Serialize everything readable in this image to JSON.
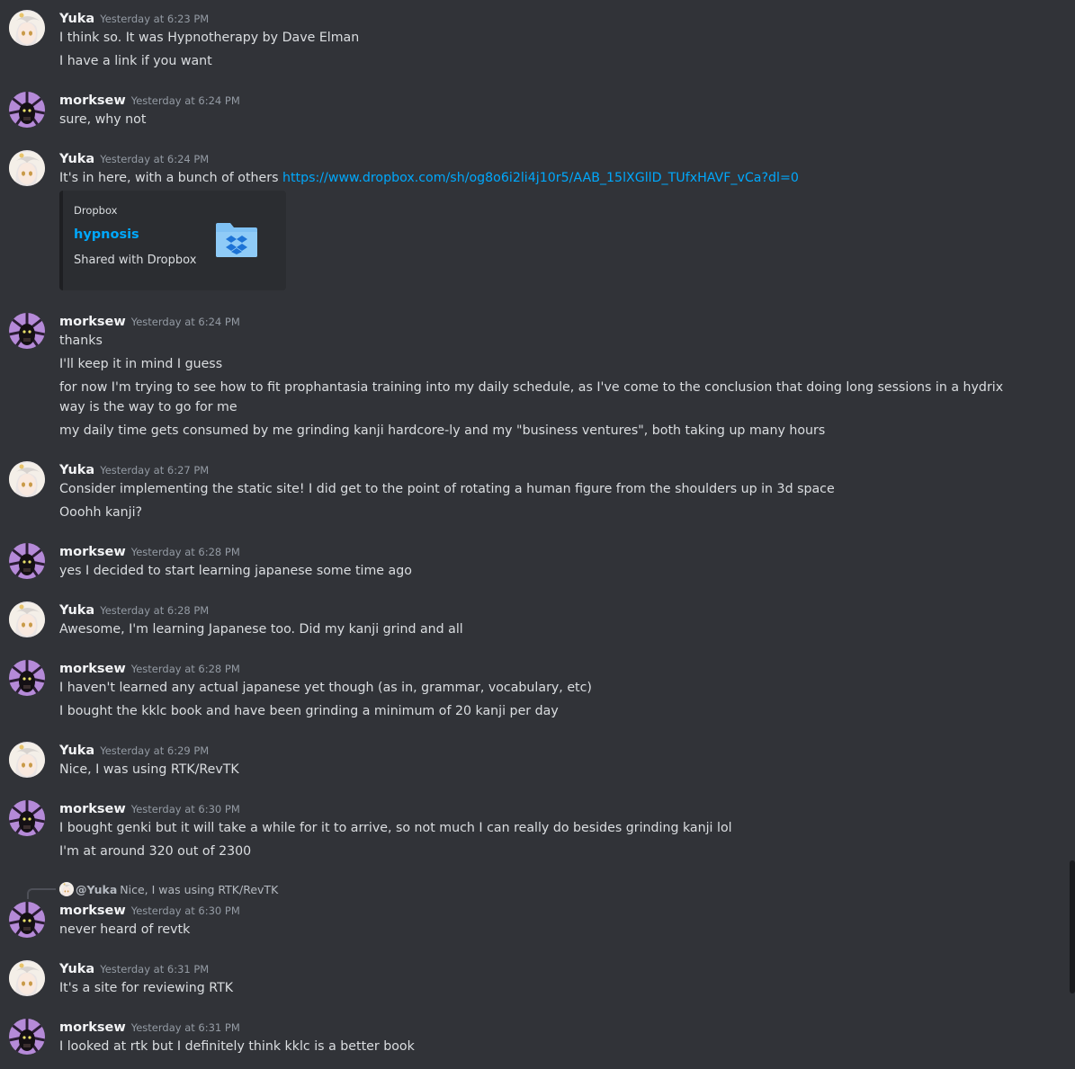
{
  "messages": [
    {
      "author": "Yuka",
      "avatar": "yuka",
      "time": "Yesterday at 6:23 PM",
      "lines": [
        "I think so. It was Hypnotherapy by Dave Elman",
        "I have a link if you want"
      ]
    },
    {
      "author": "morksew",
      "avatar": "morksew",
      "time": "Yesterday at 6:24 PM",
      "lines": [
        "sure, why not"
      ]
    },
    {
      "author": "Yuka",
      "avatar": "yuka",
      "time": "Yesterday at 6:24 PM",
      "text": "It's in here, with a bunch of others ",
      "link": "https://www.dropbox.com/sh/og8o6i2li4j10r5/AAB_15lXGllD_TUfxHAVF_vCa?dl=0",
      "embed": {
        "provider": "Dropbox",
        "title": "hypnosis",
        "description": "Shared with Dropbox",
        "icon": "dropbox-folder-icon"
      }
    },
    {
      "author": "morksew",
      "avatar": "morksew",
      "time": "Yesterday at 6:24 PM",
      "lines": [
        "thanks",
        "I'll keep it in mind I guess",
        "for now I'm trying to see how to fit prophantasia training into my daily schedule, as I've come to the conclusion that doing long sessions in a hydrix way is the way to go for me",
        "my daily time gets consumed by me grinding kanji hardcore-ly and my \"business ventures\", both taking up many hours"
      ]
    },
    {
      "author": "Yuka",
      "avatar": "yuka",
      "time": "Yesterday at 6:27 PM",
      "lines": [
        "Consider implementing the static site! I did get to the point of rotating a human figure from the shoulders up in 3d space",
        "Ooohh kanji?"
      ]
    },
    {
      "author": "morksew",
      "avatar": "morksew",
      "time": "Yesterday at 6:28 PM",
      "lines": [
        "yes I decided to start learning japanese some time ago"
      ]
    },
    {
      "author": "Yuka",
      "avatar": "yuka",
      "time": "Yesterday at 6:28 PM",
      "lines": [
        "Awesome, I'm learning Japanese too. Did my kanji grind and all"
      ]
    },
    {
      "author": "morksew",
      "avatar": "morksew",
      "time": "Yesterday at 6:28 PM",
      "lines": [
        "I haven't learned any actual japanese yet though (as in, grammar, vocabulary, etc)",
        "I bought the kklc book and have been grinding a minimum of 20 kanji per day"
      ]
    },
    {
      "author": "Yuka",
      "avatar": "yuka",
      "time": "Yesterday at 6:29 PM",
      "lines": [
        "Nice, I was using RTK/RevTK"
      ]
    },
    {
      "author": "morksew",
      "avatar": "morksew",
      "time": "Yesterday at 6:30 PM",
      "lines": [
        "I bought genki but it will take a while for it to arrive, so not much I can really do besides grinding kanji lol",
        "I'm at around 320 out of 2300"
      ]
    },
    {
      "author": "morksew",
      "avatar": "morksew",
      "time": "Yesterday at 6:30 PM",
      "reply": {
        "mention": "@Yuka",
        "text": "Nice, I was using RTK/RevTK"
      },
      "lines": [
        "never heard of revtk"
      ]
    },
    {
      "author": "Yuka",
      "avatar": "yuka",
      "time": "Yesterday at 6:31 PM",
      "lines": [
        "It's a site for reviewing RTK"
      ]
    },
    {
      "author": "morksew",
      "avatar": "morksew",
      "time": "Yesterday at 6:31 PM",
      "lines": [
        "I looked at rtk but I definitely think kklc is a better book"
      ]
    }
  ]
}
